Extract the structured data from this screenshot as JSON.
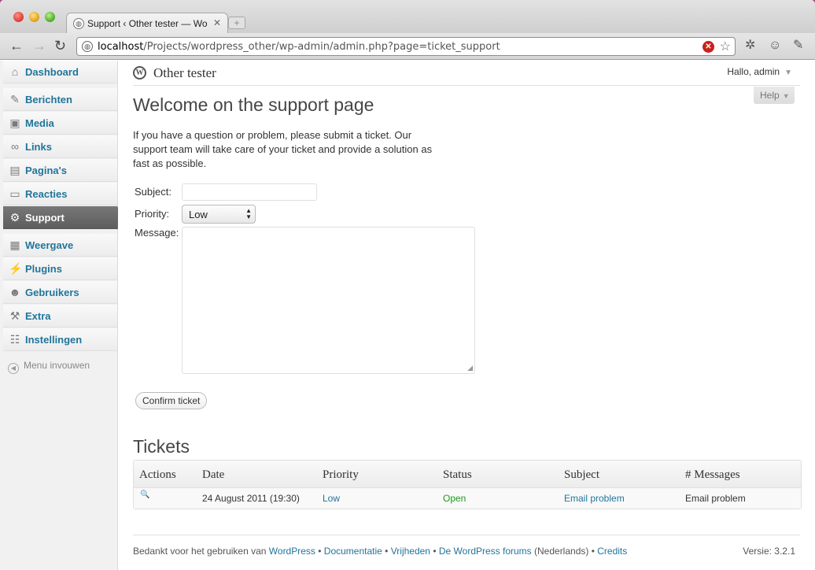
{
  "browser": {
    "tab_title": "Support ‹ Other tester — Wo",
    "tab_favicon": "globe-icon",
    "url_host": "localhost",
    "url_path": "/Projects/wordpress_other/wp-admin/admin.php?page=ticket_support"
  },
  "admin_bar": {
    "site_name": "Other tester",
    "greeting": "Hallo, admin",
    "help_label": "Help"
  },
  "sidebar": {
    "items": [
      {
        "label": "Dashboard",
        "icon": "house-icon"
      },
      {
        "label": "Berichten",
        "icon": "pushpin-icon"
      },
      {
        "label": "Media",
        "icon": "media-icon"
      },
      {
        "label": "Links",
        "icon": "chain-link-icon"
      },
      {
        "label": "Pagina's",
        "icon": "pages-icon"
      },
      {
        "label": "Reacties",
        "icon": "comment-bubble-icon"
      },
      {
        "label": "Support",
        "icon": "gear-icon"
      },
      {
        "label": "Weergave",
        "icon": "appearance-icon"
      },
      {
        "label": "Plugins",
        "icon": "plug-icon"
      },
      {
        "label": "Gebruikers",
        "icon": "users-icon"
      },
      {
        "label": "Extra",
        "icon": "tools-icon"
      },
      {
        "label": "Instellingen",
        "icon": "sliders-icon"
      }
    ],
    "active": "Support",
    "collapse_label": "Menu invouwen"
  },
  "main": {
    "title": "Welcome on the support page",
    "intro": "If you have a question or problem, please submit a ticket. Our support team will take care of your ticket and provide a solution as fast as possible.",
    "form": {
      "subject_label": "Subject:",
      "subject_value": "",
      "priority_label": "Priority:",
      "priority_value": "Low",
      "message_label": "Message:",
      "message_value": "",
      "submit_label": "Confirm ticket"
    },
    "tickets": {
      "title": "Tickets",
      "columns": [
        "Actions",
        "Date",
        "Priority",
        "Status",
        "Subject",
        "# Messages"
      ],
      "rows": [
        {
          "action_icon": "key-icon",
          "date": "24 August 2011 (19:30)",
          "priority": "Low",
          "status": "Open",
          "subject": "Email problem",
          "messages": "Email problem"
        }
      ]
    }
  },
  "footer": {
    "prefix": "Bedankt voor het gebruiken van ",
    "wordpress": "WordPress",
    "sep1": " • ",
    "documentatie": "Documentatie",
    "sep2": " • ",
    "vrijheden": "Vrijheden",
    "sep3": " • ",
    "forums": "De WordPress forums",
    "forums_suffix": " (Nederlands) • ",
    "credits": "Credits",
    "version": "Versie: 3.2.1"
  },
  "colors": {
    "link": "#21759b",
    "open_status": "#1a9b1a",
    "active_menu": "#6a6a6a"
  }
}
